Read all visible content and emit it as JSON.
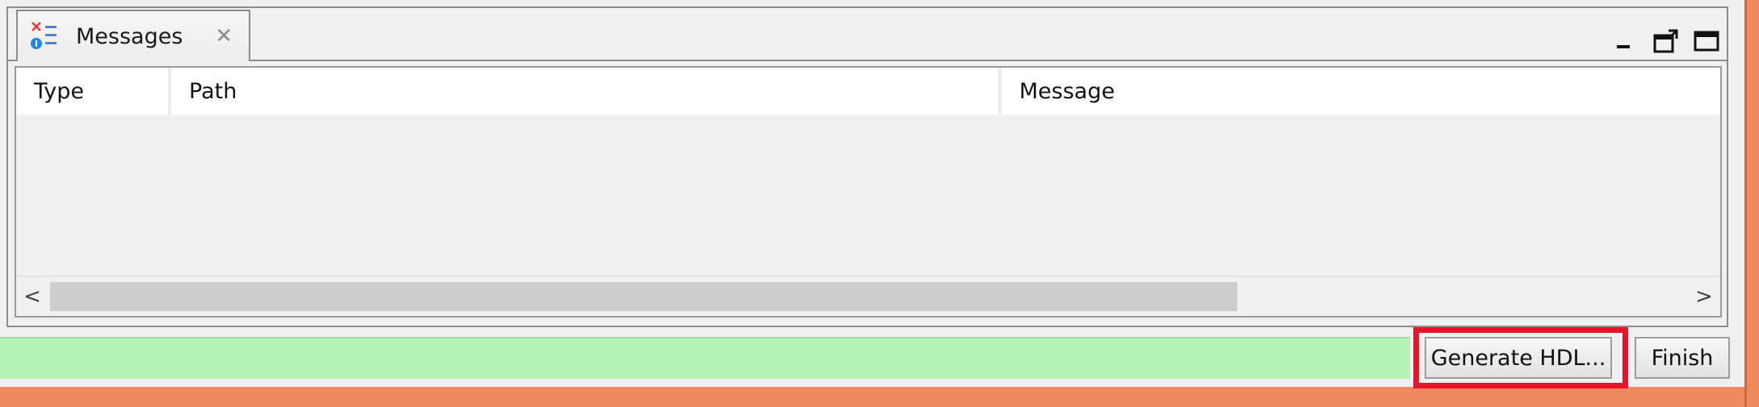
{
  "view": {
    "tab_label": "Messages",
    "tab_close_glyph": "✕",
    "controls": [
      "minimize-icon",
      "restore-icon",
      "maximize-icon"
    ]
  },
  "table": {
    "columns": [
      "Type",
      "Path",
      "Message"
    ],
    "rows": []
  },
  "scrollbar": {
    "left_arrow": "<",
    "right_arrow": ">"
  },
  "buttons": {
    "generate": "Generate HDL...",
    "finish": "Finish"
  },
  "colors": {
    "status_bar": "#b5f2b5",
    "highlight": "#e5142a",
    "window_border": "#f08a5e"
  }
}
